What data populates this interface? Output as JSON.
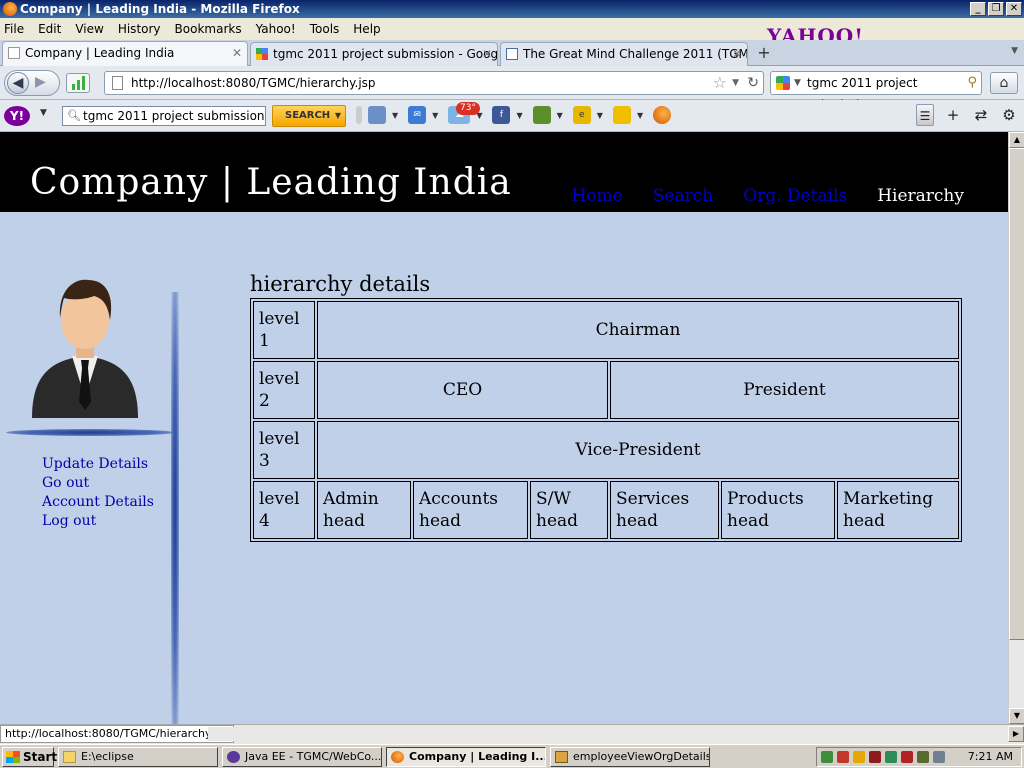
{
  "window": {
    "title": "Company | Leading India - Mozilla Firefox",
    "buttons": [
      "_",
      "❐",
      "✕"
    ]
  },
  "menubar": {
    "items": [
      "File",
      "Edit",
      "View",
      "History",
      "Bookmarks",
      "Yahoo!",
      "Tools",
      "Help"
    ],
    "brand": "YAHOO!"
  },
  "tabs": [
    {
      "label": "Company | Leading India",
      "active": true
    },
    {
      "label": "tgmc 2011 project submission - Google S...",
      "active": false
    },
    {
      "label": "The Great Mind Challenge 2011 (TGMC 2...",
      "active": false
    }
  ],
  "navbar": {
    "url": "http://localhost:8080/TGMC/hierarchy.jsp",
    "search_value": "tgmc 2011 project submission"
  },
  "yahoo_toolbar": {
    "search_value": "tgmc 2011 project submission",
    "search_button": "SEARCH",
    "weather_badge": "73°"
  },
  "site": {
    "title": "Company | Leading India",
    "nav": [
      {
        "label": "Home",
        "current": false
      },
      {
        "label": "Search",
        "current": false
      },
      {
        "label": "Org. Details",
        "current": false
      },
      {
        "label": "Hierarchy",
        "current": true
      }
    ],
    "sidebar_links": [
      "Update Details",
      "Go out",
      "Account Details",
      "Log out"
    ]
  },
  "hierarchy": {
    "title": "hierarchy details",
    "levels": [
      {
        "label": "level 1",
        "cells": [
          {
            "text": "Chairman",
            "span": 6
          }
        ]
      },
      {
        "label": "level 2",
        "cells": [
          {
            "text": "CEO",
            "span": 3
          },
          {
            "text": "President",
            "span": 3
          }
        ]
      },
      {
        "label": "level 3",
        "cells": [
          {
            "text": "Vice-President",
            "span": 6
          }
        ]
      },
      {
        "label": "level 4",
        "cells": [
          {
            "text": "Admin head",
            "span": 1
          },
          {
            "text": "Accounts head",
            "span": 1
          },
          {
            "text": "S/W head",
            "span": 1
          },
          {
            "text": "Services head",
            "span": 1
          },
          {
            "text": "Products head",
            "span": 1
          },
          {
            "text": "Marketing head",
            "span": 1
          }
        ]
      }
    ]
  },
  "statusbar": {
    "text": "http://localhost:8080/TGMC/hierarchy.jsp"
  },
  "taskbar": {
    "start": "Start",
    "tasks": [
      {
        "label": "E:\\eclipse",
        "active": false
      },
      {
        "label": "Java EE - TGMC/WebCo...",
        "active": false
      },
      {
        "label": "Company | Leading I...",
        "active": true
      },
      {
        "label": "employeeViewOrgDetails...",
        "active": false
      }
    ],
    "clock": "7:21 AM"
  },
  "colors": {
    "page_background": "#c0d0e8",
    "header_background": "#000000",
    "nav_link": "#0000cc",
    "sidebar_link": "#0000aa",
    "sidebar_rule": "#1f3d8a"
  }
}
